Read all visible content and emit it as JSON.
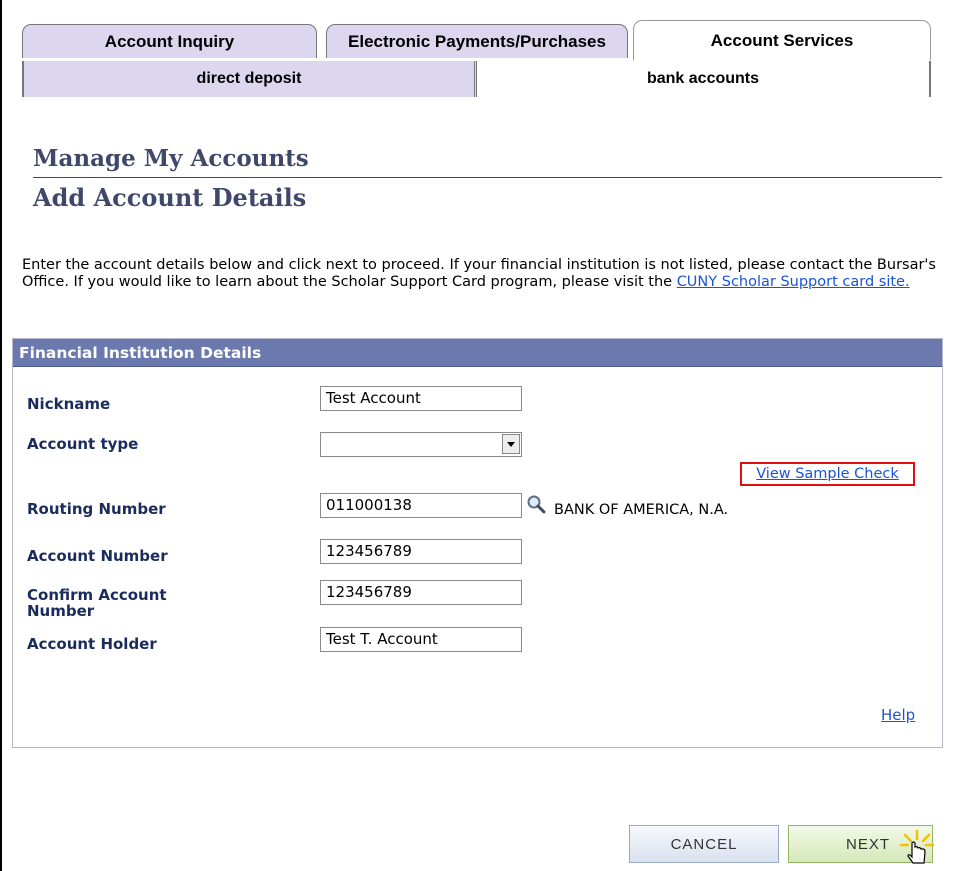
{
  "tabs": [
    {
      "label": "Account Inquiry"
    },
    {
      "label": "Electronic Payments/Purchases"
    },
    {
      "label": "Account Services"
    }
  ],
  "subtabs": [
    {
      "label": "direct deposit"
    },
    {
      "label": "bank accounts"
    }
  ],
  "page": {
    "title": "Manage My Accounts",
    "subtitle": "Add Account Details",
    "intro_text": "Enter the account details below and click next to proceed. If your financial institution is not listed, please contact the Bursar's Office. If you would like to learn about the Scholar Support Card program, please visit the ",
    "intro_link": "CUNY Scholar Support card site."
  },
  "groupbox": {
    "header": "Financial Institution Details",
    "nickname": {
      "label": "Nickname",
      "value": "Test Account"
    },
    "account_type": {
      "label": "Account type",
      "value": ""
    },
    "sample_check_link": "View Sample Check",
    "routing": {
      "label": "Routing Number",
      "value": "011000138",
      "bank_name": "BANK OF AMERICA, N.A."
    },
    "account_number": {
      "label": "Account Number",
      "value": "123456789"
    },
    "confirm_account": {
      "label": "Confirm Account Number",
      "value": "123456789"
    },
    "holder": {
      "label": "Account Holder",
      "value": "Test T. Account"
    },
    "help_link": "Help"
  },
  "buttons": {
    "cancel": "CANCEL",
    "next": "NEXT"
  },
  "colors": {
    "tab_inactive": "#dcd7ef",
    "group_header": "#6b79ae",
    "heading": "#40486a",
    "link": "#1a54d6",
    "highlight_box": "#e01010"
  },
  "icons": [
    "magnifier-icon",
    "dropdown-arrow-icon",
    "hand-cursor-icon"
  ]
}
